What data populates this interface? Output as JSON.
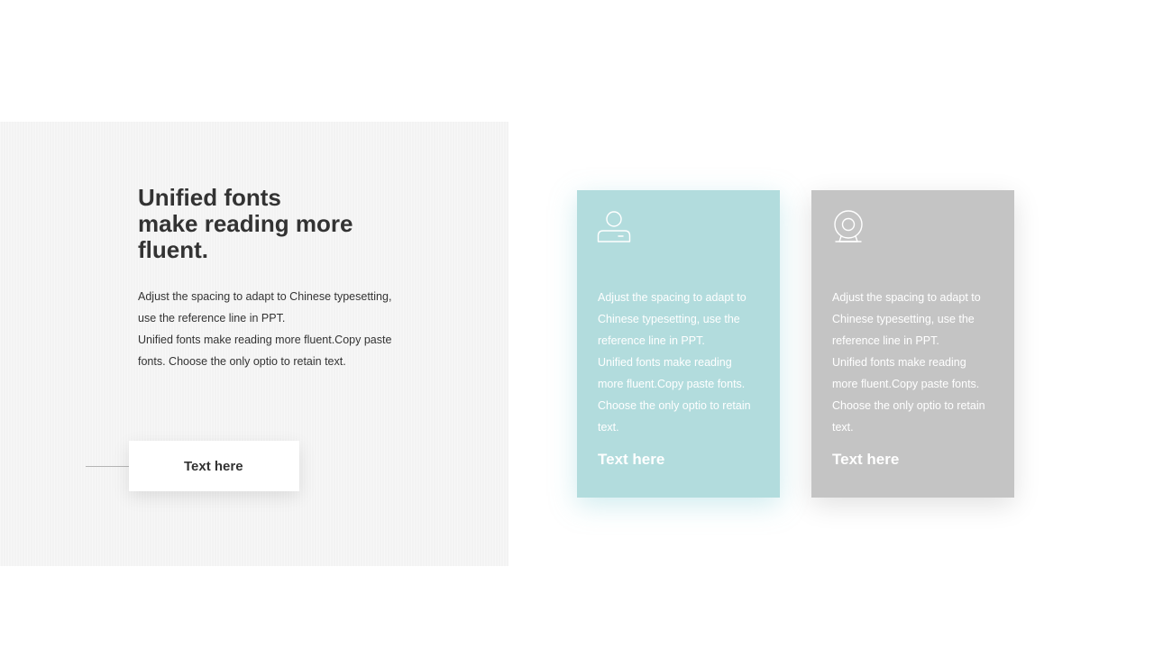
{
  "left": {
    "headline_lines": [
      "Unified fonts",
      "make reading more",
      "fluent."
    ],
    "body_lines": [
      "Adjust the spacing to adapt to Chinese typesetting,",
      "use the reference line in PPT.",
      "Unified fonts make reading more fluent.Copy paste",
      "fonts. Choose the only optio to retain text."
    ],
    "button_label": "Text here"
  },
  "cards": [
    {
      "icon": "user-icon",
      "color": "#b2dcdd",
      "body_lines": [
        "Adjust the spacing to adapt to",
        "Chinese typesetting, use the",
        "reference line in PPT.",
        "Unified fonts make reading",
        "more fluent.Copy paste fonts.",
        "Choose the only optio to retain",
        "text."
      ],
      "footer": "Text here"
    },
    {
      "icon": "webcam-icon",
      "color": "#c4c4c4",
      "body_lines": [
        "Adjust the spacing to adapt to",
        "Chinese typesetting, use the",
        "reference line in PPT.",
        "Unified fonts make reading",
        "more fluent.Copy paste fonts.",
        "Choose the only optio to retain",
        "text."
      ],
      "footer": "Text here"
    }
  ]
}
